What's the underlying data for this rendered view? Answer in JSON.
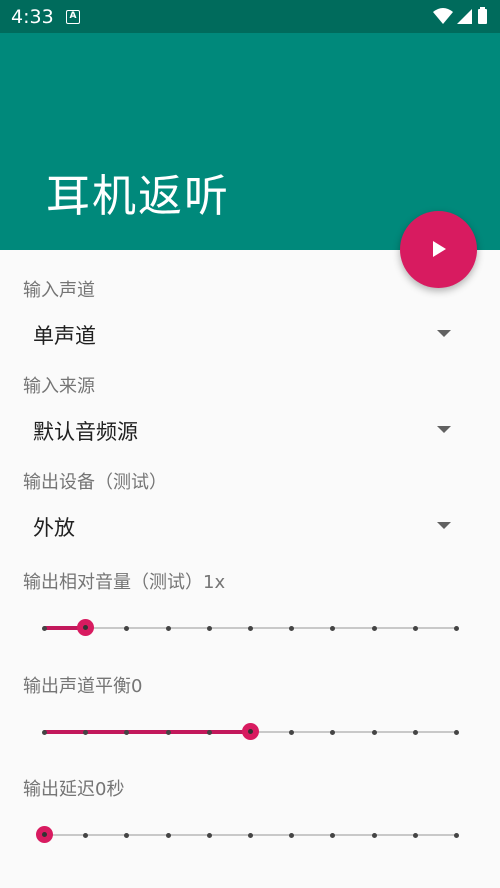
{
  "status_bar": {
    "time": "4:33",
    "notification_icon": "a-icon",
    "icons": [
      "wifi-icon",
      "signal-icon",
      "battery-icon"
    ]
  },
  "app_bar": {
    "title": "耳机返听",
    "fab_icon": "play-icon"
  },
  "colors": {
    "primary": "#00897b",
    "primary_dark": "#006b5c",
    "accent": "#d81b60"
  },
  "settings": {
    "input_channel": {
      "label": "输入声道",
      "value": "单声道"
    },
    "input_source": {
      "label": "输入来源",
      "value": "默认音频源"
    },
    "output_device": {
      "label": "输出设备（测试）",
      "value": "外放"
    },
    "output_volume": {
      "label": "输出相对音量（测试）1x",
      "position": 1,
      "steps": 10
    },
    "channel_balance": {
      "label": "输出声道平衡0",
      "position": 5,
      "steps": 10
    },
    "output_delay": {
      "label": "输出延迟0秒",
      "position": 0,
      "steps": 10
    }
  }
}
